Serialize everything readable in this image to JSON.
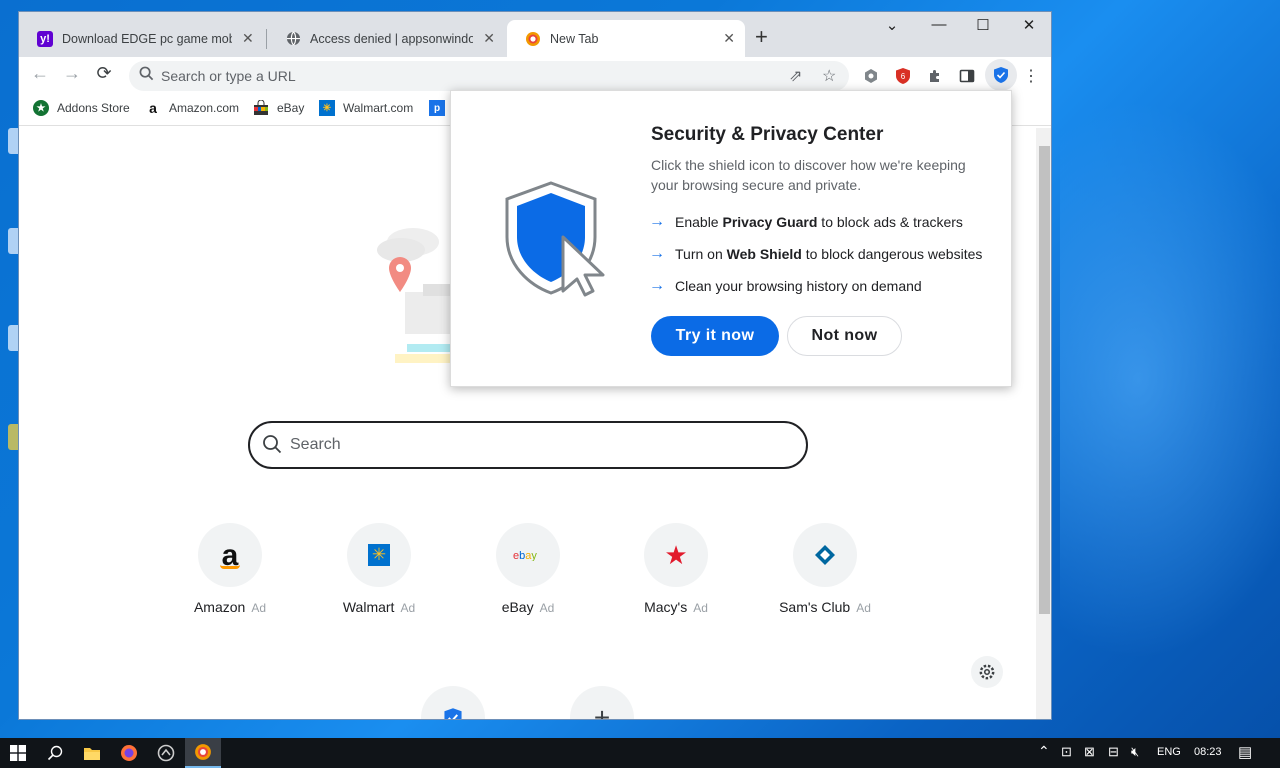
{
  "browser": {
    "tabs": [
      {
        "label": "Download EDGE pc game mobig",
        "favicon": "yahoo-icon",
        "active": false
      },
      {
        "label": "Access denied | appsonwindows",
        "favicon": "globe-icon",
        "active": false
      },
      {
        "label": "New Tab",
        "favicon": "browser-logo-icon",
        "active": true
      }
    ],
    "omnibox_placeholder": "Search or type a URL",
    "bookmarks": [
      {
        "label": "Addons Store",
        "icon": "addons-store-icon"
      },
      {
        "label": "Amazon.com",
        "icon": "amazon-icon"
      },
      {
        "label": "eBay",
        "icon": "ebay-bag-icon"
      },
      {
        "label": "Walmart.com",
        "icon": "walmart-icon"
      },
      {
        "label": "",
        "icon": "p-icon"
      }
    ]
  },
  "newtab": {
    "search_placeholder": "Search",
    "ad_label": "Ad",
    "tiles": [
      {
        "label": "Amazon",
        "icon": "amazon-icon"
      },
      {
        "label": "Walmart",
        "icon": "walmart-icon"
      },
      {
        "label": "eBay",
        "icon": "ebay-icon"
      },
      {
        "label": "Macy's",
        "icon": "macys-star-icon"
      },
      {
        "label": "Sam's Club",
        "icon": "sams-club-icon"
      }
    ]
  },
  "popup": {
    "title": "Security & Privacy Center",
    "description": "Click the shield icon to discover how we're keeping your browsing secure and private.",
    "items": [
      {
        "prefix": "Enable ",
        "bold": "Privacy Guard",
        "suffix": " to block ads & trackers"
      },
      {
        "prefix": "Turn on ",
        "bold": "Web Shield",
        "suffix": " to block dangerous websites"
      },
      {
        "prefix": "Clean your browsing history on demand",
        "bold": "",
        "suffix": ""
      }
    ],
    "primary_button": "Try it now",
    "secondary_button": "Not now"
  },
  "taskbar": {
    "language": "ENG",
    "time": "08:23"
  },
  "colors": {
    "accent": "#0b6be6",
    "desktop": "#0a6fd0",
    "taskbar": "#101418"
  }
}
